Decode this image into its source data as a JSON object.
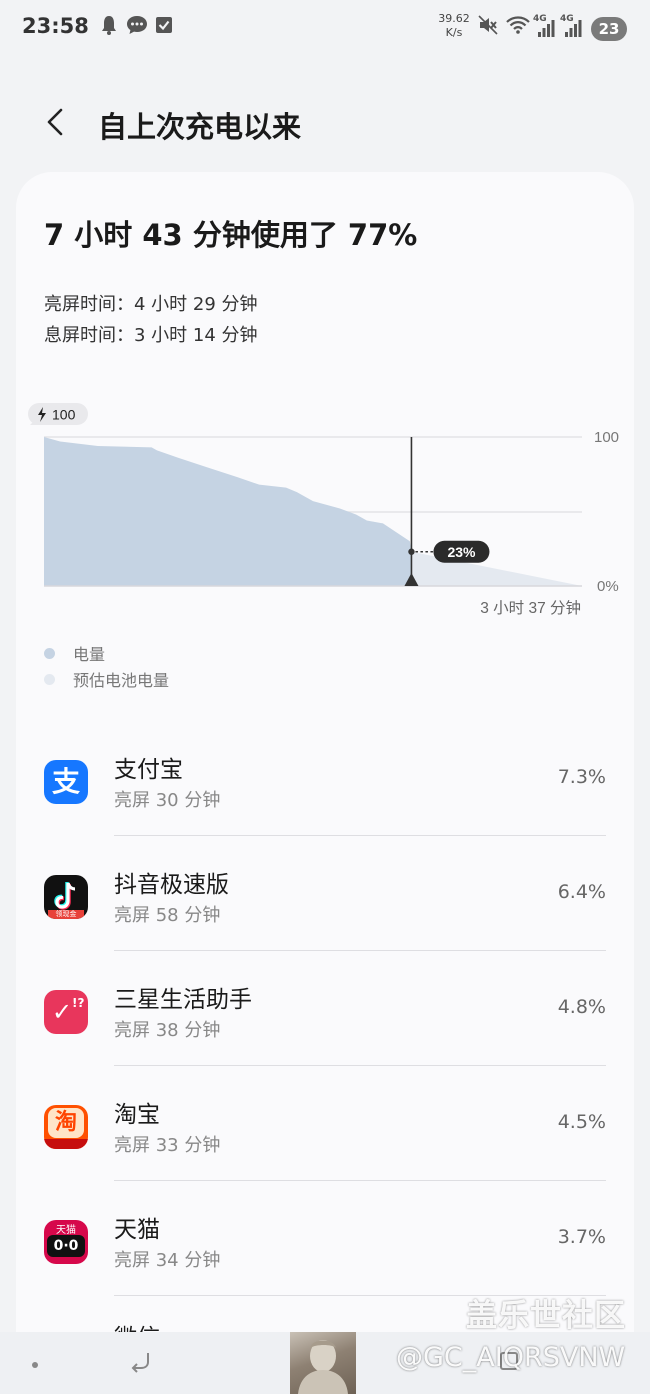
{
  "status_bar": {
    "time": "23:58",
    "net_speed_value": "39.62",
    "net_speed_unit": "K/s",
    "signal_label_1": "4G",
    "signal_label_2": "4G",
    "battery": "23",
    "icons": [
      "notification-bell-icon",
      "message-bubble-icon",
      "checkbox-icon",
      "mute-icon",
      "wifi-icon",
      "signal-icon",
      "signal-icon"
    ]
  },
  "header": {
    "title": "自上次充电以来"
  },
  "summary": {
    "usage": "7 小时 43 分钟使用了 77%",
    "screen_on": "亮屏时间：4 小时 29 分钟",
    "screen_off": "息屏时间：3 小时 14 分钟"
  },
  "chart_data": {
    "type": "area",
    "start_badge": "100",
    "y_tick_labels": [
      "100",
      "0%"
    ],
    "ylim": [
      0,
      100
    ],
    "series": [
      {
        "name": "电量",
        "color": "#c5d3e3",
        "x_fraction": [
          0,
          0.03,
          0.1,
          0.2,
          0.21,
          0.25,
          0.3,
          0.36,
          0.4,
          0.45,
          0.47,
          0.5,
          0.55,
          0.58,
          0.6,
          0.63,
          0.68,
          0.683
        ],
        "y": [
          100,
          97,
          94,
          93,
          91,
          86,
          80,
          73,
          68,
          66,
          63,
          57,
          52,
          48,
          44,
          42,
          30,
          23
        ]
      },
      {
        "name": "预估电池电量",
        "color": "#e4e9f0",
        "x_fraction": [
          0.683,
          1.0
        ],
        "y": [
          23,
          0
        ]
      }
    ],
    "marker_label": "23%",
    "time_remaining": "3 小时 37 分钟"
  },
  "legend": [
    {
      "label": "电量",
      "color": "#c5d3e3"
    },
    {
      "label": "预估电池电量",
      "color": "#e4e9f0"
    }
  ],
  "apps": [
    {
      "name": "支付宝",
      "screen_time": "亮屏 30 分钟",
      "percent": "7.3%",
      "icon": "alipay-icon"
    },
    {
      "name": "抖音极速版",
      "screen_time": "亮屏 58 分钟",
      "percent": "6.4%",
      "icon": "douyin-lite-icon"
    },
    {
      "name": "三星生活助手",
      "screen_time": "亮屏 38 分钟",
      "percent": "4.8%",
      "icon": "samsung-reminder-icon"
    },
    {
      "name": "淘宝",
      "screen_time": "亮屏 33 分钟",
      "percent": "4.5%",
      "icon": "taobao-icon"
    },
    {
      "name": "天猫",
      "screen_time": "亮屏 34 分钟",
      "percent": "3.7%",
      "icon": "tmall-icon"
    }
  ],
  "partial_app_name": "微信",
  "watermark": {
    "site": "盖乐世社区",
    "user": "@GC_AIQRSVNW"
  },
  "app_icon_text": {
    "alipay": "支",
    "douyin_badge": "领现金",
    "samsung": "✓",
    "taobao": "淘",
    "tmall_top": "天猫",
    "tmall_face": "0·0"
  }
}
